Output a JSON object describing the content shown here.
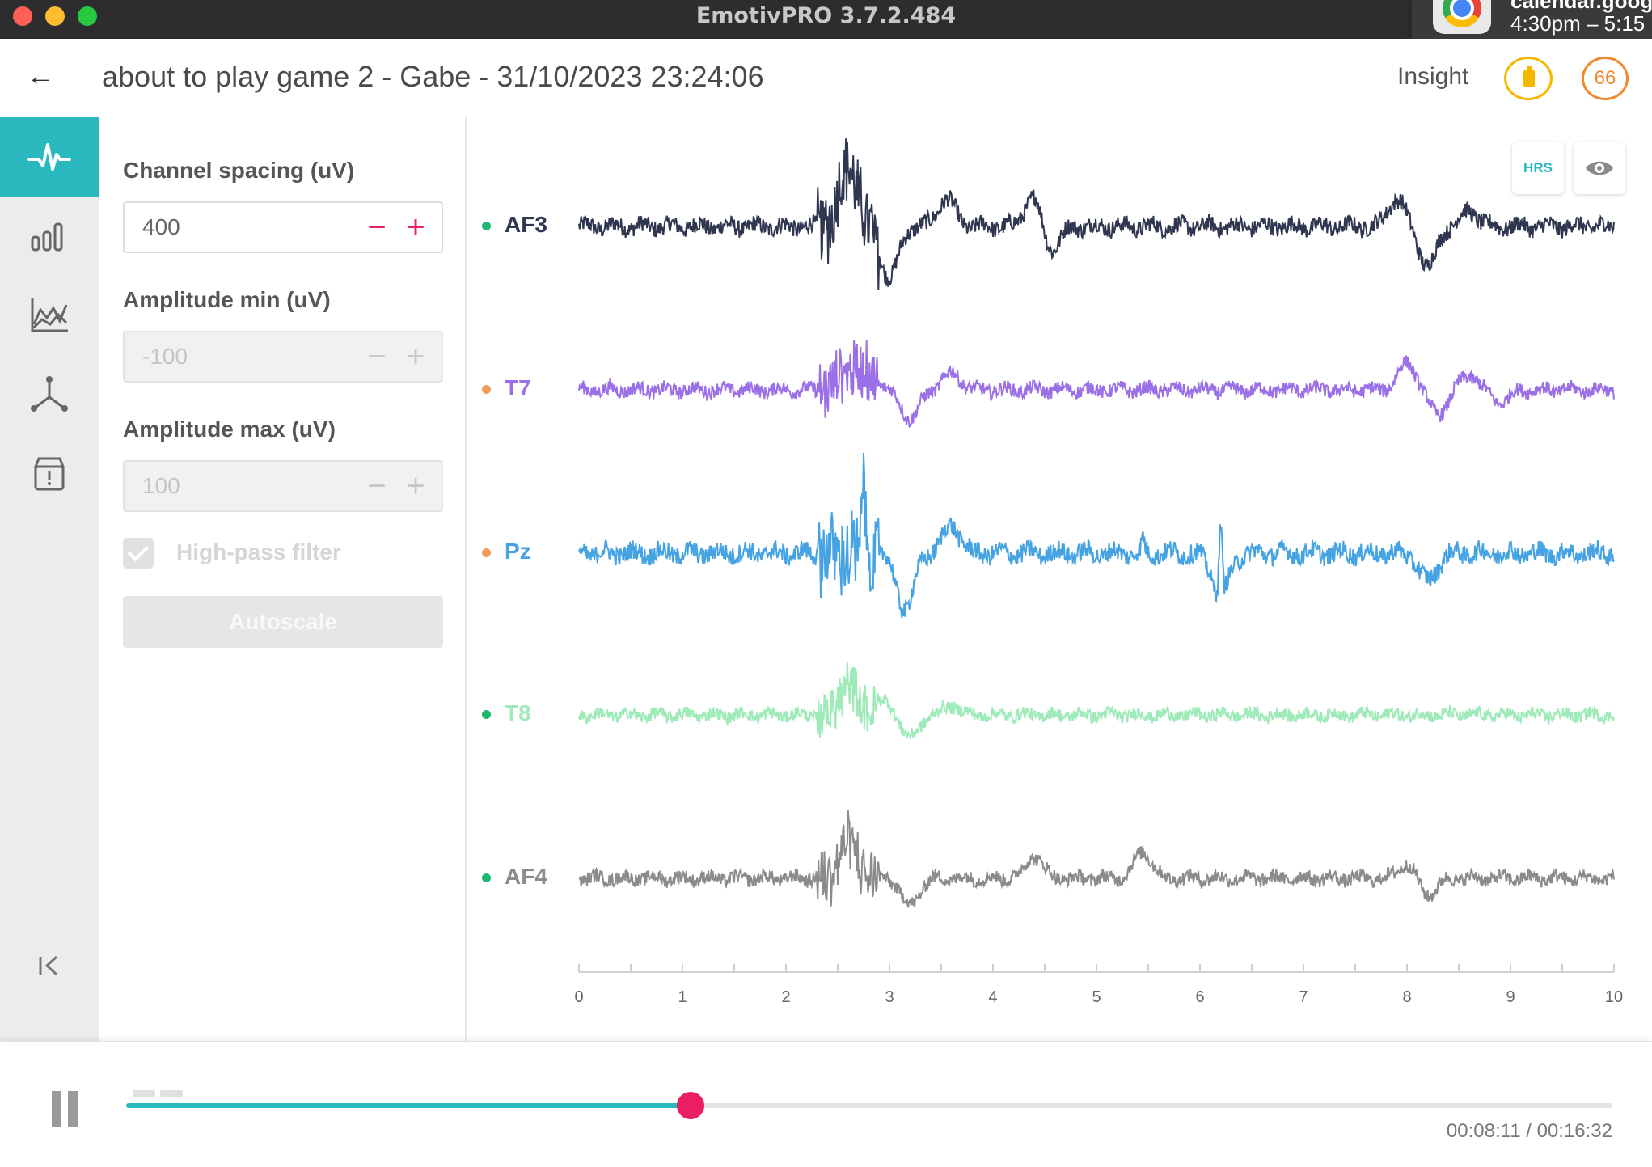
{
  "window": {
    "title": "EmotivPRO 3.7.2.484"
  },
  "notification": {
    "title": "calendar.goog",
    "time": "4:30pm – 5:15"
  },
  "header": {
    "title": "about to play game 2 - Gabe - 31/10/2023 23:24:06",
    "headset": "Insight",
    "contact_quality": "66"
  },
  "sidebar": {
    "items": [
      "waveform-icon",
      "bar-chart-icon",
      "line-chart-icon",
      "motion-axes-icon",
      "storage-alert-icon"
    ],
    "collapse": "collapse-icon"
  },
  "settings": {
    "channel_spacing": {
      "label": "Channel spacing (uV)",
      "value": "400"
    },
    "amplitude_min": {
      "label": "Amplitude min (uV)",
      "value": "-100"
    },
    "amplitude_max": {
      "label": "Amplitude max (uV)",
      "value": "100"
    },
    "high_pass": {
      "label": "High-pass filter",
      "checked": true
    },
    "autoscale_label": "Autoscale"
  },
  "plot_buttons": {
    "hrs": "HRS",
    "eye": "eye-icon"
  },
  "channels": [
    {
      "name": "AF3",
      "color": "#2f3650",
      "dot": "#1fb870"
    },
    {
      "name": "T7",
      "color": "#9b6fe8",
      "dot": "#f29a57"
    },
    {
      "name": "Pz",
      "color": "#46a3e3",
      "dot": "#f29a57"
    },
    {
      "name": "T8",
      "color": "#9eeab8",
      "dot": "#1fb870"
    },
    {
      "name": "AF4",
      "color": "#8b8b8b",
      "dot": "#1fb870"
    }
  ],
  "chart_data": {
    "type": "line",
    "x_ticks": [
      "0",
      "1",
      "2",
      "3",
      "4",
      "5",
      "6",
      "7",
      "8",
      "9",
      "10"
    ],
    "xlim": [
      0,
      10
    ],
    "series": [
      {
        "name": "AF3",
        "events": [
          [
            2.6,
            1.0
          ],
          [
            3.0,
            -0.85
          ],
          [
            3.55,
            0.45
          ],
          [
            4.4,
            0.55
          ],
          [
            4.55,
            -0.45
          ],
          [
            7.9,
            0.45
          ],
          [
            8.2,
            -0.65
          ],
          [
            8.6,
            0.25
          ]
        ]
      },
      {
        "name": "T7",
        "events": [
          [
            2.6,
            0.45
          ],
          [
            2.8,
            0.3
          ],
          [
            3.2,
            -0.6
          ],
          [
            3.6,
            0.35
          ],
          [
            8.0,
            0.55
          ],
          [
            8.3,
            -0.5
          ],
          [
            8.6,
            0.3
          ],
          [
            8.9,
            -0.25
          ]
        ]
      },
      {
        "name": "Pz",
        "events": [
          [
            2.75,
            1.2
          ],
          [
            3.15,
            -0.8
          ],
          [
            3.6,
            0.4
          ],
          [
            5.45,
            1.3
          ],
          [
            5.45,
            -1.1
          ],
          [
            6.2,
            1.05
          ],
          [
            6.2,
            -0.6
          ],
          [
            8.2,
            -0.4
          ]
        ]
      },
      {
        "name": "T8",
        "events": [
          [
            2.6,
            0.6
          ],
          [
            2.95,
            0.3
          ],
          [
            3.2,
            -0.5
          ],
          [
            3.6,
            0.2
          ]
        ]
      },
      {
        "name": "AF4",
        "events": [
          [
            2.6,
            0.75
          ],
          [
            3.2,
            -0.55
          ],
          [
            4.4,
            0.45
          ],
          [
            5.45,
            0.55
          ],
          [
            8.0,
            0.3
          ],
          [
            8.2,
            -0.35
          ]
        ]
      }
    ]
  },
  "playback": {
    "progress": 0.38,
    "time": "00:08:11 / 00:16:32",
    "pause_icon": "pause-icon"
  }
}
